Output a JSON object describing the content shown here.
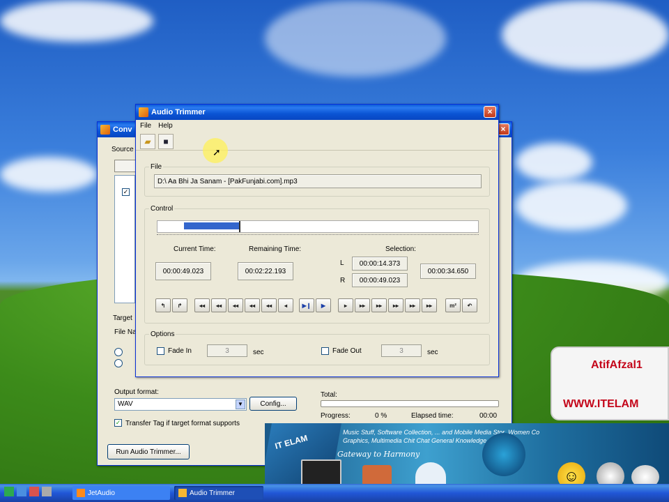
{
  "audio_trimmer": {
    "title": "Audio Trimmer",
    "menu": [
      "File",
      "Help"
    ],
    "file_group": {
      "legend": "File",
      "path": "D:\\ Aa Bhi Ja Sanam - [PakFunjabi.com].mp3"
    },
    "control_group": {
      "legend": "Control",
      "current_time_label": "Current Time:",
      "current_time": "00:00:49.023",
      "remaining_time_label": "Remaining Time:",
      "remaining_time": "00:02:22.193",
      "selection_label": "Selection:",
      "l_label": "L",
      "l_value": "00:00:14.373",
      "r_label": "R",
      "r_value": "00:00:49.023",
      "selection_length": "00:00:34.650",
      "selection_range": {
        "start_fraction": 0.083,
        "end_fraction": 0.254
      }
    },
    "options_group": {
      "legend": "Options",
      "fade_in_label": "Fade In",
      "fade_in_value": "3",
      "fade_out_label": "Fade Out",
      "fade_out_value": "3",
      "sec_label": "sec"
    }
  },
  "back_window": {
    "title": "Conv",
    "source_label": "Source",
    "target_label": "Target",
    "file_name_label": "File Na",
    "output_format_label": "Output format:",
    "output_format_value": "WAV",
    "config_label": "Config...",
    "transfer_tag_label": "Transfer Tag if target format supports",
    "run_label": "Run Audio Trimmer...",
    "total_label": "Total:",
    "progress_label": "Progress:",
    "progress_value": "0 %",
    "elapsed_label": "Elapsed time:",
    "elapsed_value": "00:00"
  },
  "taskbar": {
    "items": [
      "JetAudio",
      "Audio Trimmer"
    ]
  },
  "ad": {
    "name": "AtifAfzal1",
    "url": "WWW.ITELAM",
    "banner_line1": "Music Stuff, Software Collection, ... and Mobile Media Stor ,Women Co",
    "banner_line2": "Graphics, Multimedia Chit Chat            General Knowledge, Fun & Ma",
    "banner_logo": "IT ELAM",
    "banner_slogan": "Gateway to Harmony"
  },
  "colors": {
    "title_blue": "#0a54d4",
    "window_bg": "#ece9d8",
    "selection_blue": "#3366cc"
  }
}
